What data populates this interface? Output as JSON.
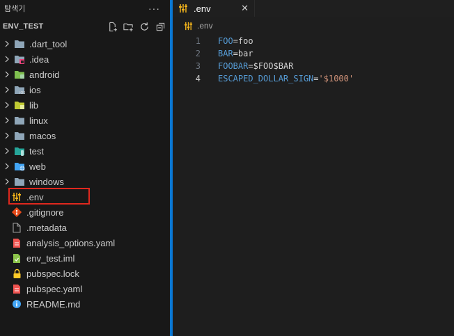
{
  "sidebar": {
    "title": "탐색기",
    "more_label": "···",
    "section_name": "ENV_TEST",
    "items": [
      {
        "label": ".dart_tool",
        "type": "folder",
        "icon": "folder-icon",
        "color": "#8fa6b8"
      },
      {
        "label": ".idea",
        "type": "folder",
        "icon": "idea-folder-icon",
        "color": "#8fa6b8"
      },
      {
        "label": "android",
        "type": "folder",
        "icon": "android-folder-icon",
        "color": "#7fbf4f"
      },
      {
        "label": "ios",
        "type": "folder",
        "icon": "ios-folder-icon",
        "color": "#8fa6b8"
      },
      {
        "label": "lib",
        "type": "folder",
        "icon": "lib-folder-icon",
        "color": "#c0ca33"
      },
      {
        "label": "linux",
        "type": "folder",
        "icon": "folder-icon",
        "color": "#8fa6b8"
      },
      {
        "label": "macos",
        "type": "folder",
        "icon": "folder-icon",
        "color": "#8fa6b8"
      },
      {
        "label": "test",
        "type": "folder",
        "icon": "test-folder-icon",
        "color": "#26a69a"
      },
      {
        "label": "web",
        "type": "folder",
        "icon": "web-folder-icon",
        "color": "#42a5f5"
      },
      {
        "label": "windows",
        "type": "folder",
        "icon": "folder-icon",
        "color": "#8fa6b8"
      },
      {
        "label": ".env",
        "type": "file",
        "icon": "env-file-icon",
        "color": "#f2b31b"
      },
      {
        "label": ".gitignore",
        "type": "file",
        "icon": "git-icon",
        "color": "#e64a19"
      },
      {
        "label": ".metadata",
        "type": "file",
        "icon": "document-icon",
        "color": "#9e9e9e"
      },
      {
        "label": "analysis_options.yaml",
        "type": "file",
        "icon": "yaml-icon",
        "color": "#ef5350"
      },
      {
        "label": "env_test.iml",
        "type": "file",
        "icon": "iml-icon",
        "color": "#8bc34a"
      },
      {
        "label": "pubspec.lock",
        "type": "file",
        "icon": "lock-icon",
        "color": "#ffca28"
      },
      {
        "label": "pubspec.yaml",
        "type": "file",
        "icon": "yaml-icon",
        "color": "#ef5350"
      },
      {
        "label": "README.md",
        "type": "file",
        "icon": "info-icon",
        "color": "#42a5f5"
      }
    ]
  },
  "editor": {
    "tab_label": ".env",
    "tab_close": "✕",
    "breadcrumb": ".env",
    "lines": [
      {
        "num": "1",
        "key": "FOO",
        "eq": "=",
        "value": "foo",
        "value_type": "plain"
      },
      {
        "num": "2",
        "key": "BAR",
        "eq": "=",
        "value": "bar",
        "value_type": "plain"
      },
      {
        "num": "3",
        "key": "FOOBAR",
        "eq": "=",
        "value": "$FOO$BAR",
        "value_type": "plain"
      },
      {
        "num": "4",
        "key": "ESCAPED_DOLLAR_SIGN",
        "eq": "=",
        "value": "'$1000'",
        "value_type": "string"
      }
    ],
    "active_line": "4"
  },
  "colors": {
    "accent": "#0a78d4",
    "highlight_border": "#e0281e"
  }
}
